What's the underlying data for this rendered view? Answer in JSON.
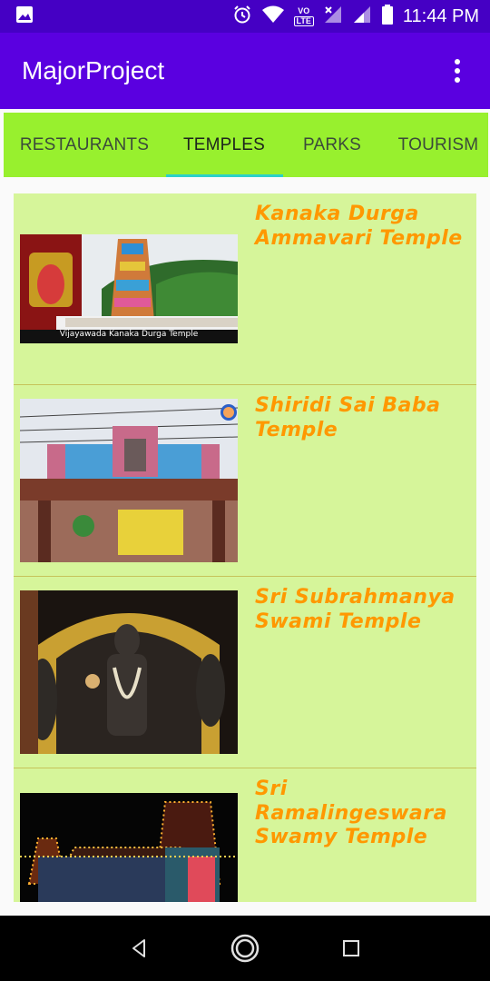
{
  "status_bar": {
    "time": "11:44 PM",
    "icons": [
      "image-icon",
      "alarm-icon",
      "wifi-icon",
      "volte-icon",
      "signal-icon",
      "signal-icon",
      "battery-icon"
    ],
    "volte_top": "VO",
    "volte_bottom": "LTE"
  },
  "app_bar": {
    "title": "MajorProject",
    "menu_icon": "more-vert-icon"
  },
  "tabs": [
    {
      "label": "RESTAURANTS",
      "active": false
    },
    {
      "label": "TEMPLES",
      "active": true
    },
    {
      "label": "PARKS",
      "active": false
    },
    {
      "label": "TOURISM",
      "active": false
    }
  ],
  "temples": [
    {
      "title": "Kanaka Durga Ammavari Temple",
      "caption": "Vijayawada Kanaka Durga Temple"
    },
    {
      "title": "Shiridi Sai Baba Temple",
      "caption": ""
    },
    {
      "title": "Sri Subrahmanya Swami Temple",
      "caption": ""
    },
    {
      "title": "Sri Ramalingeswara Swamy Temple",
      "caption": ""
    }
  ],
  "nav_bar": {
    "icons": [
      "back-icon",
      "home-icon",
      "recents-icon"
    ]
  },
  "colors": {
    "status_bar": "#4500c4",
    "app_bar": "#5a00e0",
    "tab_bar": "#98f02e",
    "tab_indicator": "#2ad1c8",
    "card_bg": "#d6f59a",
    "title_text": "#ff9800"
  }
}
